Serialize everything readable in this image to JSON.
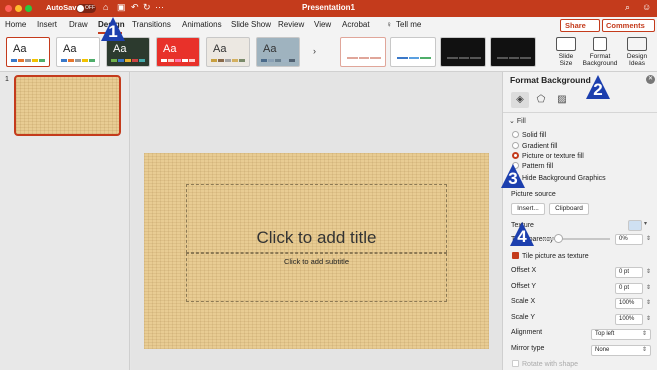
{
  "titlebar": {
    "autosave_label": "AutoSave",
    "autosave_state": "OFF",
    "document_title": "Presentation1",
    "colors": {
      "bar": "#c43b1c",
      "close": "#fe5f57",
      "min": "#febc2e",
      "max": "#28c840"
    }
  },
  "menu": {
    "tabs": [
      "Home",
      "Insert",
      "Draw",
      "Design",
      "Transitions",
      "Animations",
      "Slide Show",
      "Review",
      "View",
      "Acrobat",
      "Tell me"
    ],
    "active_tab": "Design",
    "share_label": "Share",
    "comments_label": "Comments"
  },
  "ribbon": {
    "themes": [
      {
        "label": "Aa",
        "bg": "#ffffff",
        "fg": "#222222"
      },
      {
        "label": "Aa",
        "bg": "#ffffff",
        "fg": "#222222"
      },
      {
        "label": "Aa",
        "bg": "#2c3a2e",
        "fg": "#ffffff"
      },
      {
        "label": "Aa",
        "bg": "#e8312a",
        "fg": "#ffffff"
      },
      {
        "label": "Aa",
        "bg": "#ece8e2",
        "fg": "#333333"
      },
      {
        "label": "Aa",
        "bg": "#9fb3bf",
        "fg": "#333333"
      }
    ],
    "slide_size_label": "Slide\nSize",
    "format_background_label": "Format\nBackground",
    "design_ideas_label": "Design\nIdeas"
  },
  "slide_panel": {
    "slide_number": "1"
  },
  "slide": {
    "title_placeholder": "Click to add title",
    "subtitle_placeholder": "Click to add subtitle"
  },
  "format_pane": {
    "title": "Format Background",
    "fill_header": "Fill",
    "options": [
      {
        "label": "Solid fill",
        "selected": false
      },
      {
        "label": "Gradient fill",
        "selected": false
      },
      {
        "label": "Picture or texture fill",
        "selected": true
      },
      {
        "label": "Pattern fill",
        "selected": false
      }
    ],
    "hide_graphics_label": "Hide Background Graphics",
    "picture_source_label": "Picture source",
    "insert_button": "Insert...",
    "clipboard_button": "Clipboard",
    "texture_label": "Texture",
    "transparency_label": "Transparency",
    "transparency_value": "0%",
    "tile_label": "Tile picture as texture",
    "tile_checked": true,
    "offset_x_label": "Offset X",
    "offset_x_value": "0 pt",
    "offset_y_label": "Offset Y",
    "offset_y_value": "0 pt",
    "scale_x_label": "Scale X",
    "scale_x_value": "100%",
    "scale_y_label": "Scale Y",
    "scale_y_value": "100%",
    "alignment_label": "Alignment",
    "alignment_value": "Top left",
    "mirror_label": "Mirror type",
    "mirror_value": "None",
    "rotate_label": "Rotate with shape"
  },
  "callouts": [
    "1",
    "2",
    "3",
    "4"
  ],
  "accent_color": "#c43b1c",
  "callout_color": "#1c3fae"
}
